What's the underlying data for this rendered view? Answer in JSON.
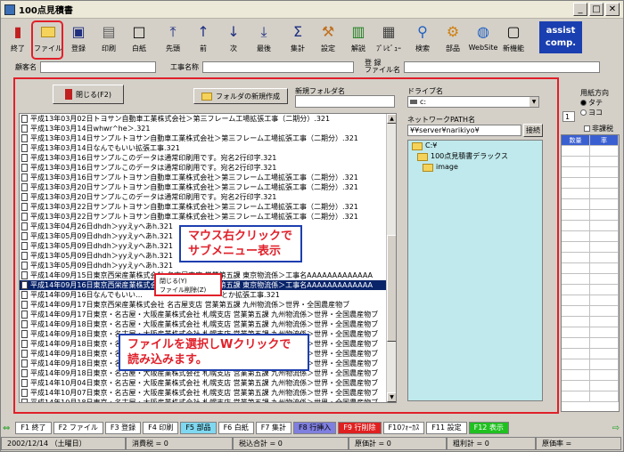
{
  "window": {
    "title": "100点見積書"
  },
  "toolbar": {
    "buttons": [
      {
        "label": "終了"
      },
      {
        "label": "ファイル"
      },
      {
        "label": "登録"
      },
      {
        "label": "印刷"
      },
      {
        "label": "白紙"
      },
      {
        "label": "先頭"
      },
      {
        "label": "前"
      },
      {
        "label": "次"
      },
      {
        "label": "最後"
      },
      {
        "label": "集計"
      },
      {
        "label": "設定"
      },
      {
        "label": "解説"
      },
      {
        "label": "ﾌﾟﾚﾋﾞｭｰ"
      },
      {
        "label": "検索"
      },
      {
        "label": "部品"
      },
      {
        "label": "WebSite"
      },
      {
        "label": "新機能"
      }
    ],
    "logo": [
      "assist",
      "comp."
    ]
  },
  "header": {
    "customer_label": "顧客名",
    "project_label": "工事名称",
    "code_label": "登 録",
    "filename_label": "ファイル名"
  },
  "dialog": {
    "close_button": "閉じる(F2)",
    "new_folder_button": "フォルダの新規作成",
    "new_folder_label": "新規フォルダ名",
    "drive_label": "ドライブ名",
    "drive_value": "c:",
    "network_label": "ネットワークPATH名",
    "network_value": "¥¥server¥narikiyo¥",
    "connect_button": "接続",
    "tree": [
      {
        "name": "C:¥"
      },
      {
        "name": "100点見積書デラックス"
      },
      {
        "name": "image"
      }
    ],
    "files": [
      "平成13年03月02日トヨサン自動車工業株式会社＞第三フレーム工場拡張工事（二期分）.321",
      "平成13年03月14日whwr^he＞.321",
      "平成13年03月14日サンプルトヨサン自動車工業株式会社＞第三フレーム工場拡張工事（二期分）.321",
      "平成13年03月14日なんでもいい拡張工事.321",
      "平成13年03月16日サンプルこのデータは通常印刷用です。宛名2行印字.321",
      "平成13年03月16日サンプルこのデータは通常印刷用です。宛名2行印字.321",
      "平成13年03月16日サンプルトヨサン自動車工業株式会社＞第三フレーム工場拡張工事（二期分）.321",
      "平成13年03月20日サンプルトヨサン自動車工業株式会社＞第三フレーム工場拡張工事（二期分）.321",
      "平成13年03月20日サンプルこのデータは通常印刷用です。宛名2行印字.321",
      "平成13年03月22日サンプルトヨサン自動車工業株式会社＞第三フレーム工場拡張工事（二期分）.321",
      "平成13年03月22日サンプルトヨサン自動車工業株式会社＞第三フレーム工場拡張工事（二期分）.321",
      "平成13年04月26日dhdh＞yyえyへあh.321",
      "平成13年05月09日dhdh＞yyえyへあh.321",
      "平成13年05月09日dhdh＞yyえyへあh.321",
      "平成13年05月09日dhdh＞yyえyへあh.321",
      "平成13年05月09日dhdh＞yyえyへあh.321",
      "平成14年09月15日東京西栄産業株式会社 名古屋支店 営業第五課 東京物流係＞工事名AAAAAAAAAAAAA",
      "平成14年09月16日東京西栄産業株式会社 名古屋支店 営業第五課 東京物流係＞工事名AAAAAAAAAAAAA",
      "平成14年09月16日なんでもいい…　　　　　　　　　　　とか拡張工事.321",
      "平成14年09月17日東京西栄産業株式会社 名古屋支店 営業第五課 九州物流係＞世界・全国農産物ブ",
      "平成14年09月17日東京・名古屋・大阪産業株式会社 札幌支店 営業第五課 九州物流係＞世界・全国農産物ブ",
      "平成14年09月18日東京・名古屋・大阪産業株式会社 札幌支店 営業第五課 九州物流係＞世界・全国農産物ブ",
      "平成14年09月18日東京・名古屋・大阪産業株式会社 札幌支店 営業第五課 九州物流係＞世界・全国農産物ブ",
      "平成14年09月18日東京・名古屋・大阪産業株式会社 札幌支店 営業第五課 九州物流係＞世界・全国農産物ブ",
      "平成14年09月18日東京・名古屋・大阪産業株式会社 札幌支店 営業第五課 九州物流係＞世界・全国農産物ブ",
      "平成14年09月18日東京・名古屋・大阪産業株式会社 札幌支店 営業第五課 九州物流係＞世界・全国農産物ブ",
      "平成14年09月18日東京・名古屋・大阪産業株式会社 札幌支店 営業第五課 九州物流係＞世界・全国農産物ブ",
      "平成14年10月04日東京・名古屋・大阪産業株式会社 札幌支店 営業第五課 九州物流係＞世界・全国農産物ブ",
      "平成14年10月07日東京・名古屋・大阪産業株式会社 札幌支店 営業第五課 九州物流係＞世界・全国農産物ブ",
      "平成14年10月18日東京・名古屋・大阪産業株式会社 札幌支店 営業第五課 九州物流係＞世界・全国農産物ブ"
    ],
    "context_menu": [
      "閉じる(Y)",
      "ファイル削除(Z)"
    ],
    "callout_top": [
      "マウス右クリックで",
      "サブメニュー表示"
    ],
    "callout_bottom": [
      "ファイルを選択しWクリックで",
      "読み込みます。"
    ]
  },
  "right": {
    "direction_label": "用紙方向",
    "options": [
      "タテ",
      "ヨコ"
    ],
    "page_value": "1",
    "grid_headers": [
      "数量",
      "率"
    ],
    "nontax_label": "非課税"
  },
  "fkeys": [
    {
      "label": "F1 終了",
      "color": "#ffffff"
    },
    {
      "label": "F2 ファイル",
      "color": "#ffffff"
    },
    {
      "label": "F3 登録",
      "color": "#ffffff"
    },
    {
      "label": "F4 印刷",
      "color": "#ffffff"
    },
    {
      "label": "F5 部品",
      "color": "#7fd8f0"
    },
    {
      "label": "F6 白紙",
      "color": "#ffffff"
    },
    {
      "label": "F7 集計",
      "color": "#ffffff"
    },
    {
      "label": "F8 行挿入",
      "color": "#7f7fe0"
    },
    {
      "label": "F9 行削除",
      "color": "#e02020"
    },
    {
      "label": "F10ﾌｫｰｶｽ",
      "color": "#ffffff"
    },
    {
      "label": "F11 設定",
      "color": "#ffffff"
    },
    {
      "label": "F12 表示",
      "color": "#20c020"
    }
  ],
  "status": {
    "date": "2002/12/14 （土曜日）",
    "tax": "消費税 = 0",
    "subtotal": "税込合計 = 0",
    "cost": "原価計 = 0",
    "profit": "粗利計 = 0",
    "cost_rate": "原価率 ="
  }
}
